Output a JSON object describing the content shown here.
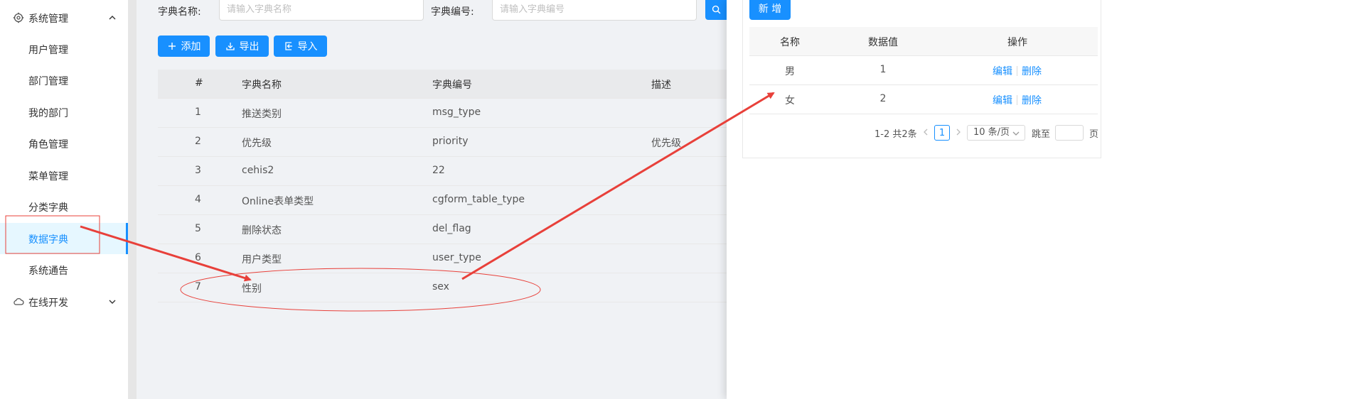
{
  "sidebar": {
    "groups": [
      {
        "label": "系统管理",
        "icon": "gear-icon",
        "expanded": true
      },
      {
        "label": "在线开发",
        "icon": "cloud-icon",
        "expanded": false
      }
    ],
    "items": [
      {
        "label": "用户管理"
      },
      {
        "label": "部门管理"
      },
      {
        "label": "我的部门"
      },
      {
        "label": "角色管理"
      },
      {
        "label": "菜单管理"
      },
      {
        "label": "分类字典"
      },
      {
        "label": "数据字典",
        "active": true
      },
      {
        "label": "系统通告"
      }
    ]
  },
  "search": {
    "name_label": "字典名称:",
    "name_placeholder": "请输入字典名称",
    "code_label": "字典编号:",
    "code_placeholder": "请输入字典编号"
  },
  "toolbar": {
    "add_label": "添加",
    "export_label": "导出",
    "import_label": "导入"
  },
  "table": {
    "headers": [
      "#",
      "字典名称",
      "字典编号",
      "描述"
    ],
    "rows": [
      {
        "index": "1",
        "name": "推送类别",
        "code": "msg_type",
        "desc": ""
      },
      {
        "index": "2",
        "name": "优先级",
        "code": "priority",
        "desc": "优先级"
      },
      {
        "index": "3",
        "name": "cehis2",
        "code": "22",
        "desc": ""
      },
      {
        "index": "4",
        "name": "Online表单类型",
        "code": "cgform_table_type",
        "desc": ""
      },
      {
        "index": "5",
        "name": "删除状态",
        "code": "del_flag",
        "desc": ""
      },
      {
        "index": "6",
        "name": "用户类型",
        "code": "user_type",
        "desc": ""
      },
      {
        "index": "7",
        "name": "性别",
        "code": "sex",
        "desc": ""
      }
    ]
  },
  "drawer": {
    "new_label": "新 增",
    "headers": [
      "名称",
      "数据值",
      "操作"
    ],
    "rows": [
      {
        "name": "男",
        "value": "1",
        "edit": "编辑",
        "delete": "删除"
      },
      {
        "name": "女",
        "value": "2",
        "edit": "编辑",
        "delete": "删除"
      }
    ],
    "pagination": {
      "total": "1-2 共2条",
      "current": "1",
      "page_size": "10 条/页",
      "jump_label": "跳至",
      "page_label": "页"
    }
  },
  "colors": {
    "primary": "#1890ff",
    "annotation": "#e8403a",
    "sidebar_active_bg": "#e6f7ff"
  }
}
